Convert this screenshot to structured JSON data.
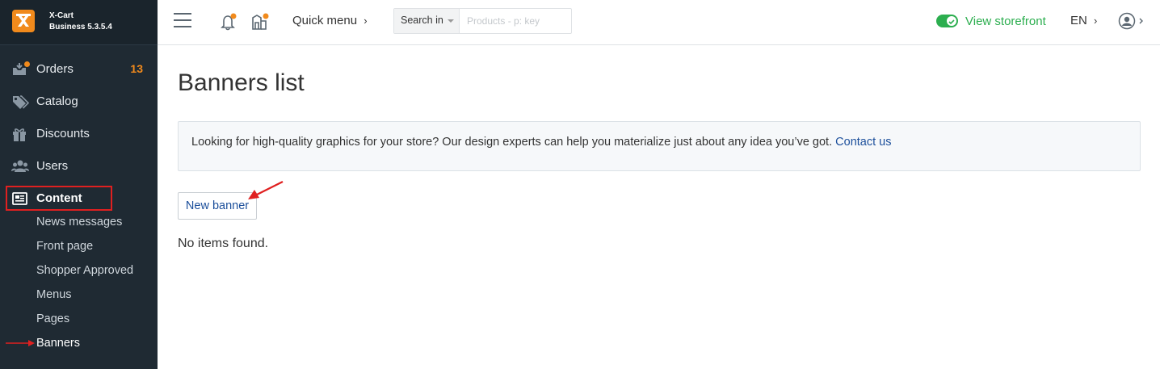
{
  "brand": {
    "name": "X-Cart",
    "edition": "Business 5.3.5.4"
  },
  "sidebar": {
    "items": [
      {
        "label": "Orders",
        "icon": "orders-icon",
        "badge": "13"
      },
      {
        "label": "Catalog",
        "icon": "tags-icon"
      },
      {
        "label": "Discounts",
        "icon": "gift-icon"
      },
      {
        "label": "Users",
        "icon": "users-icon"
      },
      {
        "label": "Content",
        "icon": "newspaper-icon"
      }
    ],
    "content_sub": [
      "News messages",
      "Front page",
      "Shopper Approved",
      "Menus",
      "Pages",
      "Banners"
    ]
  },
  "header": {
    "quick_menu": "Quick menu",
    "search_in": "Search in",
    "search_placeholder": "Products - p: key",
    "storefront": "View storefront",
    "language": "EN"
  },
  "main": {
    "title": "Banners list",
    "info_text": "Looking for high-quality graphics for your store? Our design experts can help you materialize just about any idea you’ve got.",
    "info_link": "Contact us",
    "new_banner_label": "New banner",
    "empty_text": "No items found."
  },
  "colors": {
    "sidebar_bg": "#1f2a33",
    "accent_orange": "#f18a1c",
    "link_blue": "#1c4f9b",
    "storefront_green": "#2cae4f",
    "annotation_red": "#e02020"
  }
}
